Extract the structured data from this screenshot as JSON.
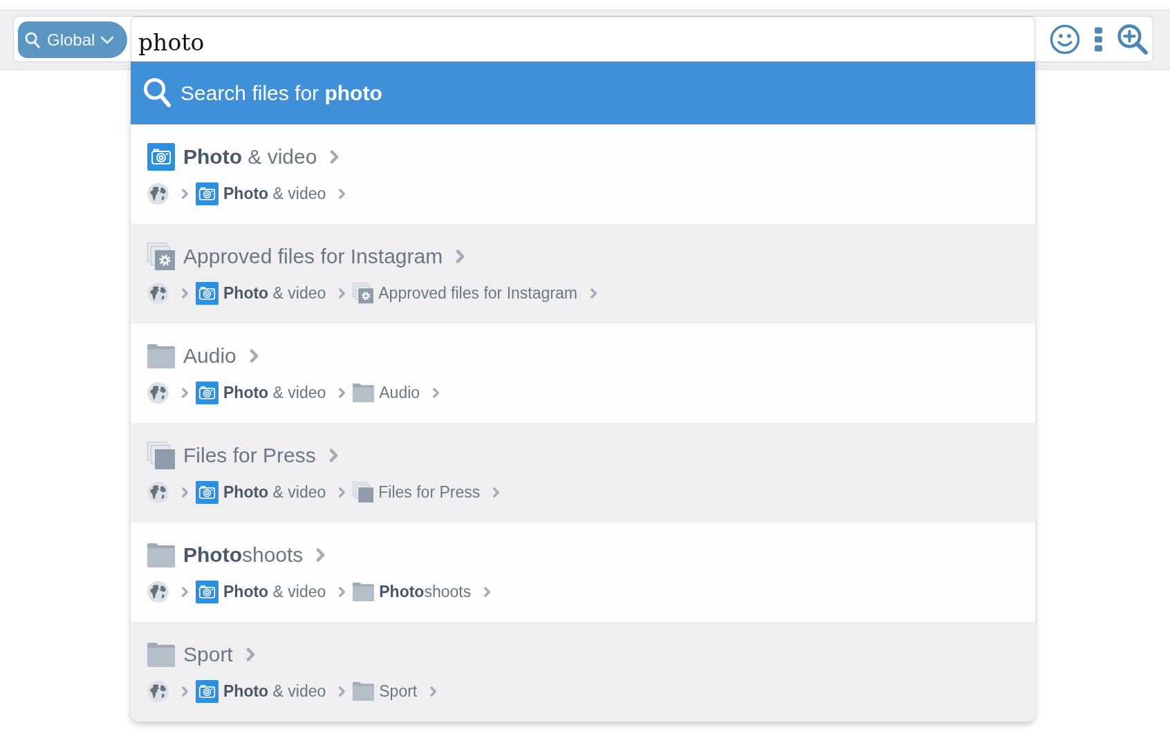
{
  "toolbar": {
    "scope_button": {
      "label": "Global"
    },
    "search_field": {
      "value": "photo"
    }
  },
  "suggestions": {
    "search_action": {
      "label": "Search files for **photo**",
      "selected": true
    },
    "results": [
      {
        "kind": "camera",
        "title": "**Photo** & video",
        "selected": false,
        "path": [
          {
            "kind": "globe"
          },
          {
            "kind": "camera",
            "label": "**Photo** & video"
          }
        ]
      },
      {
        "kind": "smart-collection",
        "title": "Approved files for Instagram",
        "selected": false,
        "path": [
          {
            "kind": "globe"
          },
          {
            "kind": "camera",
            "label": "**Photo** & video"
          },
          {
            "kind": "smart-collection",
            "label": "Approved files for Instagram"
          }
        ]
      },
      {
        "kind": "folder",
        "title": "Audio",
        "selected": false,
        "path": [
          {
            "kind": "globe"
          },
          {
            "kind": "camera",
            "label": "**Photo** & video"
          },
          {
            "kind": "folder",
            "label": "Audio"
          }
        ]
      },
      {
        "kind": "collection",
        "title": "Files for Press",
        "selected": false,
        "path": [
          {
            "kind": "globe"
          },
          {
            "kind": "camera",
            "label": "**Photo** & video"
          },
          {
            "kind": "collection",
            "label": "Files for Press"
          }
        ]
      },
      {
        "kind": "folder",
        "title": "**Photo**shoots",
        "selected": false,
        "path": [
          {
            "kind": "globe"
          },
          {
            "kind": "camera",
            "label": "**Photo** & video"
          },
          {
            "kind": "folder",
            "label": "**Photo**shoots"
          }
        ]
      },
      {
        "kind": "folder",
        "title": "Sport",
        "selected": false,
        "path": [
          {
            "kind": "globe"
          },
          {
            "kind": "camera",
            "label": "**Photo** & video"
          },
          {
            "kind": "folder",
            "label": "Sport"
          }
        ]
      }
    ]
  }
}
